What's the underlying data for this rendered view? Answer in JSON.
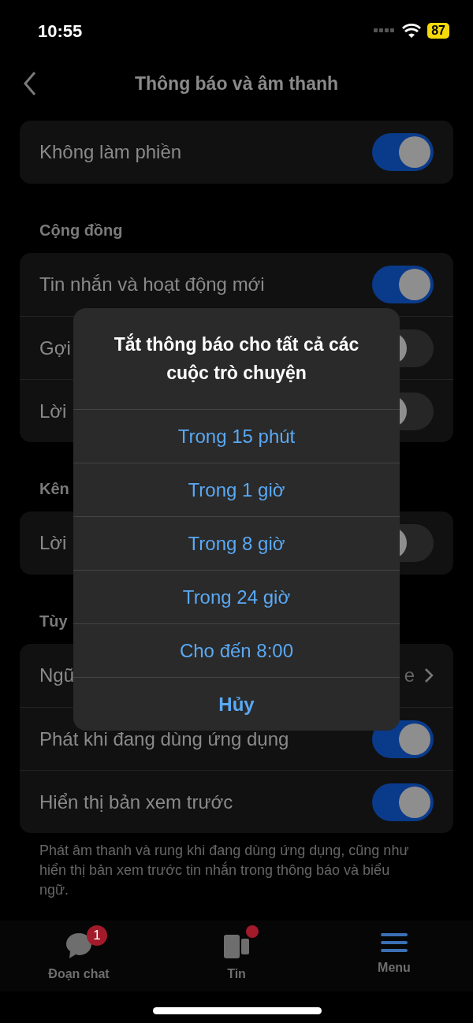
{
  "status_bar": {
    "time": "10:55",
    "battery": "87"
  },
  "nav": {
    "title": "Thông báo và âm thanh"
  },
  "sections": [
    {
      "rows": [
        {
          "label": "Không làm phiền",
          "kind": "toggle",
          "on": true
        }
      ]
    },
    {
      "header": "Cộng đồng",
      "rows": [
        {
          "label": "Tin nhắn và hoạt động mới",
          "kind": "toggle",
          "on": true
        },
        {
          "label": "Gợi",
          "kind": "toggle",
          "on": false
        },
        {
          "label": "Lời",
          "kind": "toggle",
          "on": false
        }
      ]
    },
    {
      "header": "Kên",
      "rows": [
        {
          "label": "Lời",
          "kind": "toggle",
          "on": false
        }
      ]
    },
    {
      "header": "Tùy",
      "rows": [
        {
          "label": "Ngũ",
          "kind": "link",
          "value": "e"
        },
        {
          "label": "Phát khi đang dùng ứng dụng",
          "kind": "toggle",
          "on": true
        },
        {
          "label": "Hiển thị bản xem trước",
          "kind": "toggle",
          "on": true
        }
      ],
      "footer": "Phát âm thanh và rung khi đang dùng ứng dụng, cũng như hiển thị bản xem trước tin nhắn trong thông báo và biểu ngữ."
    }
  ],
  "dialog": {
    "title": "Tắt thông báo cho tất cả các cuộc trò chuyện",
    "actions": [
      {
        "label": "Trong 15 phút",
        "kind": "default"
      },
      {
        "label": "Trong 1 giờ",
        "kind": "default"
      },
      {
        "label": "Trong 8 giờ",
        "kind": "default"
      },
      {
        "label": "Trong 24 giờ",
        "kind": "default"
      },
      {
        "label": "Cho đến 8:00",
        "kind": "default"
      },
      {
        "label": "Hủy",
        "kind": "cancel"
      }
    ]
  },
  "tab_bar": [
    {
      "label": "Đoạn chat",
      "kind": "chat",
      "badge": "1",
      "dot": false
    },
    {
      "label": "Tin",
      "kind": "stories",
      "dot": true
    },
    {
      "label": "Menu",
      "kind": "menu",
      "dot": false
    }
  ]
}
